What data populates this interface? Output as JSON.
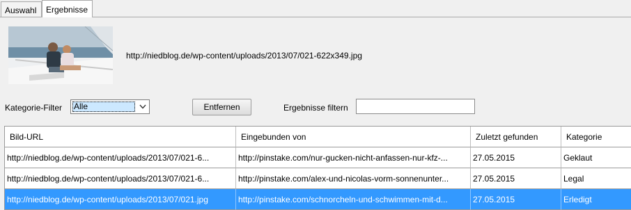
{
  "tabs": [
    {
      "label": "Auswahl",
      "active": false
    },
    {
      "label": "Ergebnisse",
      "active": true
    }
  ],
  "preview": {
    "url": "http://niedblog.de/wp-content/uploads/2013/07/021-622x349.jpg"
  },
  "filters": {
    "category_label": "Kategorie-Filter",
    "category_value": "Alle",
    "remove_label": "Entfernen",
    "results_filter_label": "Ergebnisse filtern",
    "results_filter_value": ""
  },
  "table": {
    "columns": [
      "Bild-URL",
      "Eingebunden von",
      "Zuletzt gefunden",
      "Kategorie"
    ],
    "rows": [
      {
        "bild_url": "http://niedblog.de/wp-content/uploads/2013/07/021-6...",
        "eingebunden_von": "http://pinstake.com/nur-gucken-nicht-anfassen-nur-kfz-...",
        "zuletzt_gefunden": "27.05.2015",
        "kategorie": "Geklaut",
        "selected": false
      },
      {
        "bild_url": "http://niedblog.de/wp-content/uploads/2013/07/021-6...",
        "eingebunden_von": "http://pinstake.com/alex-und-nicolas-vorm-sonnenunter...",
        "zuletzt_gefunden": "27.05.2015",
        "kategorie": "Legal",
        "selected": false
      },
      {
        "bild_url": "http://niedblog.de/wp-content/uploads/2013/07/021.jpg",
        "eingebunden_von": "http://pinstake.com/schnorcheln-und-schwimmen-mit-d...",
        "zuletzt_gefunden": "27.05.2015",
        "kategorie": "Erledigt",
        "selected": true
      }
    ]
  },
  "colors": {
    "selection": "#3399ff",
    "window_bg": "#f0f0f0"
  },
  "icons": {
    "dropdown": "chevron-down-icon"
  }
}
